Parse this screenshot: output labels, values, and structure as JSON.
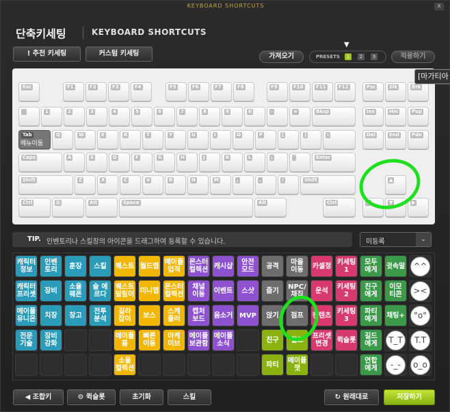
{
  "window": {
    "top_title": "KEYBOARD SHORTCUTS",
    "close_label": "x"
  },
  "header": {
    "title": "단축키세팅",
    "subtitle": "KEYBOARD SHORTCUTS"
  },
  "buttons": {
    "recommended": "! 추천 키세팅",
    "custom": "커스텀 키세팅",
    "load": "가져오기",
    "presets_label": "PRESETS",
    "presets": [
      "1",
      "2",
      "3"
    ],
    "apply": "적용하기"
  },
  "tooltip": "[마가티아",
  "keyboard": {
    "tab_label": "Tab",
    "tab_action": "메뉴이동",
    "rows": [
      [
        "Esc",
        "F1",
        "F2",
        "F3",
        "F4",
        "F5",
        "F6",
        "F7",
        "F8",
        "F9",
        "F10",
        "F11",
        "F12",
        "Psc",
        "Slk",
        "Brk"
      ],
      [
        "`",
        "1",
        "2",
        "3",
        "4",
        "5",
        "6",
        "7",
        "8",
        "9",
        "0",
        "-",
        "=",
        "Bksp",
        "Ins",
        "Hm",
        "Pup"
      ],
      [
        "Tab",
        "Q",
        "W",
        "E",
        "R",
        "T",
        "Y",
        "U",
        "I",
        "O",
        "P",
        "[",
        "]",
        "\\",
        "Del",
        "End",
        "Pdn"
      ],
      [
        "Caps",
        "A",
        "S",
        "D",
        "F",
        "G",
        "H",
        "J",
        "K",
        "L",
        ";",
        "'",
        "Enter"
      ],
      [
        "Shift",
        "Z",
        "X",
        "C",
        "V",
        "B",
        "N",
        "M",
        ",",
        ".",
        "/",
        "Shift",
        "▲"
      ],
      [
        "Ctrl",
        "⊞",
        "Alt",
        "Space",
        "Alt",
        "Ctrl",
        "◀",
        "▼",
        "▶"
      ]
    ]
  },
  "tip": {
    "label": "TIP.",
    "text": "인벤토리나 스킬창의 아이콘을 드래그하여 등록할 수 있습니다."
  },
  "dropdown": {
    "value": "미등록",
    "arrow": "⌄"
  },
  "skills": [
    [
      {
        "t": "캐릭터 정보",
        "c": "#2a9bb8"
      },
      {
        "t": "인벤 토리",
        "c": "#2a9bb8"
      },
      {
        "t": "훈장",
        "c": "#2a9bb8"
      },
      {
        "t": "스킬",
        "c": "#2a9bb8"
      },
      {
        "t": "퀘스트",
        "c": "#f2b705"
      },
      {
        "t": "월드맵",
        "c": "#f2b705"
      },
      {
        "t": "메이플 업적",
        "c": "#f2b705"
      },
      {
        "t": "몬스터 컬렉션",
        "c": "#8e52d0"
      },
      {
        "t": "캐시샵",
        "c": "#8e52d0"
      },
      {
        "t": "안전 모드",
        "c": "#8e52d0"
      },
      {
        "t": "공격",
        "c": "#6d6d6d"
      },
      {
        "t": "마을 이동",
        "c": "#6d6d6d"
      },
      {
        "t": "카셀정",
        "c": "#d83a6f"
      },
      {
        "t": "키세팅 1",
        "c": "#d83a6f"
      },
      {
        "t": "모두 에게",
        "c": "#3a9a4a"
      },
      {
        "t": "귓속말",
        "c": "#3a9a4a"
      },
      {
        "t": "^^",
        "c": "face"
      }
    ],
    [
      {
        "t": "캐릭터 프리셋",
        "c": "#2a9bb8"
      },
      {
        "t": "장비",
        "c": "#2a9bb8"
      },
      {
        "t": "소울 웨폰",
        "c": "#2a9bb8"
      },
      {
        "t": "슬 에르다",
        "c": "#2a9bb8"
      },
      {
        "t": "퀘스트 알림이",
        "c": "#f2b705"
      },
      {
        "t": "미니맵",
        "c": "#f2b705"
      },
      {
        "t": "몬스터 컬렉션",
        "c": "#f2b705"
      },
      {
        "t": "채널 이동",
        "c": "#8e52d0"
      },
      {
        "t": "이벤트",
        "c": "#8e52d0"
      },
      {
        "t": "스샷",
        "c": "#8e52d0"
      },
      {
        "t": "줍기",
        "c": "#6d6d6d"
      },
      {
        "t": "NPC/ 채집",
        "c": "#6d6d6d"
      },
      {
        "t": "운석",
        "c": "#d83a6f"
      },
      {
        "t": "키세팅 2",
        "c": "#d83a6f"
      },
      {
        "t": "친구 에게",
        "c": "#3a9a4a"
      },
      {
        "t": "이모 티콘",
        "c": "#3a9a4a"
      },
      {
        "t": "><",
        "c": "face"
      }
    ],
    [
      {
        "t": "메이플 유니온",
        "c": "#2a9bb8"
      },
      {
        "t": "치장",
        "c": "#2a9bb8"
      },
      {
        "t": "창고",
        "c": "#2a9bb8"
      },
      {
        "t": "전투 분석",
        "c": "#2a9bb8"
      },
      {
        "t": "길라 잡이",
        "c": "#f2b705"
      },
      {
        "t": "보스",
        "c": "#f2b705"
      },
      {
        "t": "스케 줄러",
        "c": "#f2b705"
      },
      {
        "t": "캡처 보드",
        "c": "#8e52d0"
      },
      {
        "t": "음소거",
        "c": "#8e52d0"
      },
      {
        "t": "MVP",
        "c": "#8e52d0"
      },
      {
        "t": "앉기",
        "c": "#6d6d6d"
      },
      {
        "t": "점프",
        "c": "#6d6d6d"
      },
      {
        "t": "컨텐츠",
        "c": "#d83a6f"
      },
      {
        "t": "키세팅 3",
        "c": "#d83a6f"
      },
      {
        "t": "파티 에게",
        "c": "#3a9a4a"
      },
      {
        "t": "채팅+",
        "c": "#3a9a4a"
      },
      {
        "t": "°o°",
        "c": "face"
      }
    ],
    [
      {
        "t": "전문 기술",
        "c": "#2a9bb8"
      },
      {
        "t": "장비 강화",
        "c": "#2a9bb8"
      },
      {
        "t": "",
        "c": ""
      },
      {
        "t": "",
        "c": ""
      },
      {
        "t": "메이플 홈",
        "c": "#f2b705"
      },
      {
        "t": "빠른 이동",
        "c": "#f2b705"
      },
      {
        "t": "아케 이브",
        "c": "#f2b705"
      },
      {
        "t": "메이플 보관함",
        "c": "#8e52d0"
      },
      {
        "t": "메이플 소식",
        "c": "#8e52d0"
      },
      {
        "t": "",
        "c": ""
      },
      {
        "t": "친구",
        "c": "#8bb310"
      },
      {
        "t": "길드",
        "c": "#8bb310"
      },
      {
        "t": "프리셋 변경",
        "c": "#d83a6f"
      },
      {
        "t": "퀵슬롯",
        "c": "#d83a6f"
      },
      {
        "t": "길드 에게",
        "c": "#3a9a4a"
      },
      {
        "t": "T_T",
        "c": "face"
      },
      {
        "t": "T.T",
        "c": "face"
      }
    ],
    [
      {
        "t": "",
        "c": ""
      },
      {
        "t": "",
        "c": ""
      },
      {
        "t": "",
        "c": ""
      },
      {
        "t": "",
        "c": ""
      },
      {
        "t": "소울 컬렉션",
        "c": "#f2b705"
      },
      {
        "t": "",
        "c": ""
      },
      {
        "t": "",
        "c": ""
      },
      {
        "t": "",
        "c": ""
      },
      {
        "t": "",
        "c": ""
      },
      {
        "t": "",
        "c": ""
      },
      {
        "t": "파티",
        "c": "#8bb310"
      },
      {
        "t": "메이플 챗",
        "c": "#8bb310"
      },
      {
        "t": "",
        "c": ""
      },
      {
        "t": "",
        "c": ""
      },
      {
        "t": "연합 에게",
        "c": "#3a9a4a"
      },
      {
        "t": "-_-",
        "c": "face"
      },
      {
        "t": "o_o",
        "c": "face"
      }
    ]
  ],
  "bottom": {
    "combo": "◀ 조합키",
    "quickslot": "⚙ 퀵슬롯",
    "reset": "초기화",
    "skill": "스킬",
    "default": "↻ 원래대로",
    "save": "저장하기"
  },
  "colors": {
    "accent_green": "#1ee01e",
    "save": "#9cc520"
  }
}
